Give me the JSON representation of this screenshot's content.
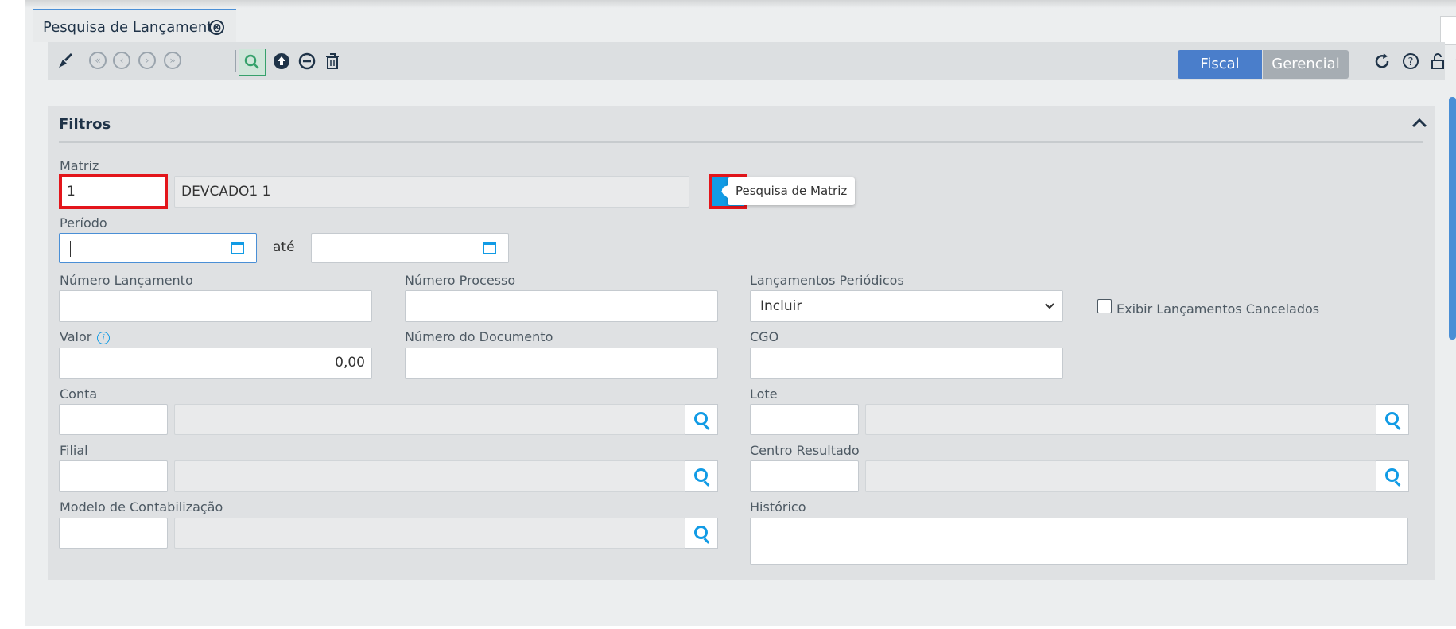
{
  "tab": {
    "title": "Pesquisa de Lançamento"
  },
  "toolbar": {
    "buttons": [
      "clean-icon",
      "first-icon",
      "prev-icon",
      "next-icon",
      "last-icon",
      "search-icon",
      "upload-icon",
      "remove-icon",
      "trash-icon"
    ],
    "fiscal_label": "Fiscal",
    "gerencial_label": "Gerencial"
  },
  "filters": {
    "title": "Filtros",
    "matriz": {
      "label": "Matriz",
      "code": "1",
      "name": "DEVCADO1 1",
      "tooltip": "Pesquisa de Matriz"
    },
    "periodo": {
      "label": "Período",
      "until": "até"
    },
    "numero_lancamento": {
      "label": "Número Lançamento"
    },
    "numero_processo": {
      "label": "Número Processo"
    },
    "lancamentos_periodicos": {
      "label": "Lançamentos Periódicos",
      "value": "Incluir"
    },
    "exibir_cancelados": {
      "label": "Exibir Lançamentos Cancelados"
    },
    "valor": {
      "label": "Valor",
      "value": "0,00"
    },
    "numero_documento": {
      "label": "Número do Documento"
    },
    "cgo": {
      "label": "CGO"
    },
    "conta": {
      "label": "Conta"
    },
    "lote": {
      "label": "Lote"
    },
    "filial": {
      "label": "Filial"
    },
    "centro_resultado": {
      "label": "Centro Resultado"
    },
    "modelo": {
      "label": "Modelo de Contabilização"
    },
    "historico": {
      "label": "Histórico"
    }
  },
  "colors": {
    "accent": "#4a7ecb",
    "search": "#119be5",
    "highlight": "#e3151b"
  }
}
